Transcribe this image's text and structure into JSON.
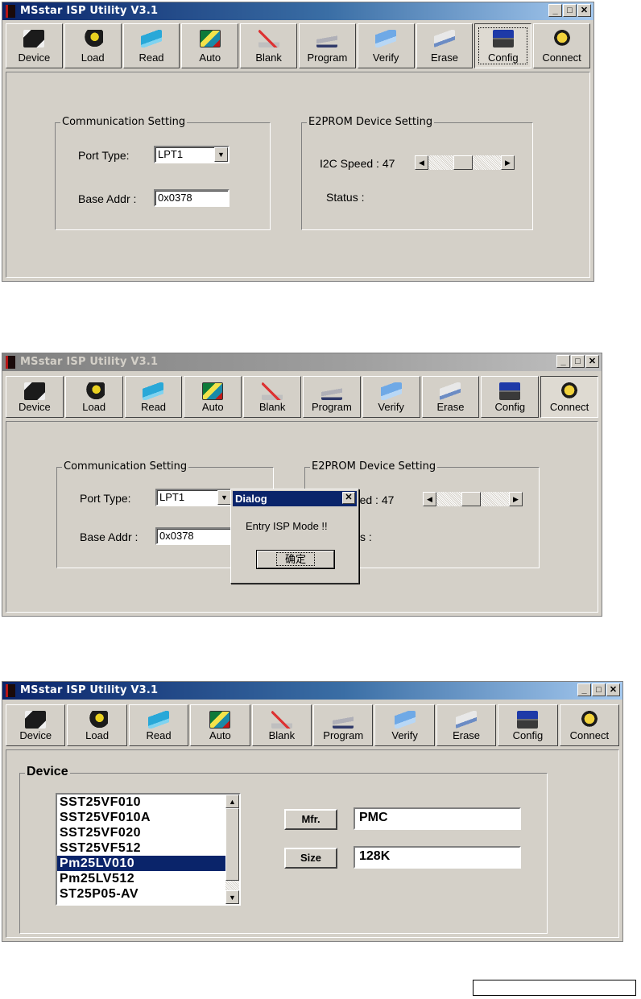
{
  "app": {
    "title": "MSstar ISP Utility V3.1"
  },
  "window_buttons": {
    "minimize": "_",
    "maximize": "□",
    "close": "✕"
  },
  "toolbar": [
    {
      "label": "Device",
      "icon": "device-chip-icon"
    },
    {
      "label": "Load",
      "icon": "load-chip-icon"
    },
    {
      "label": "Read",
      "icon": "read-book-icon"
    },
    {
      "label": "Auto",
      "icon": "auto-icon"
    },
    {
      "label": "Blank",
      "icon": "blank-check-icon"
    },
    {
      "label": "Program",
      "icon": "program-icon"
    },
    {
      "label": "Verify",
      "icon": "verify-icon"
    },
    {
      "label": "Erase",
      "icon": "erase-icon"
    },
    {
      "label": "Config",
      "icon": "config-computer-icon"
    },
    {
      "label": "Connect",
      "icon": "connect-phone-icon"
    }
  ],
  "config_panel": {
    "comm_group": "Communication Setting",
    "port_type_label": "Port Type:",
    "port_type_value": "LPT1",
    "base_addr_label": "Base Addr :",
    "base_addr_value": "0x0378",
    "e2prom_group": "E2PROM Device Setting",
    "i2c_speed_label": "I2C Speed :",
    "i2c_speed_value": "47",
    "i2c_speed_fraction": 0.47,
    "status_label": "Status :"
  },
  "dialog": {
    "title": "Dialog",
    "close": "✕",
    "message": "Entry ISP Mode !!",
    "ok_label": "确定",
    "occluded_speed_label": "peed :",
    "occluded_status_label": "s :"
  },
  "device_panel": {
    "group": "Device",
    "devices": [
      "SST25VF010",
      "SST25VF010A",
      "SST25VF020",
      "SST25VF512",
      "Pm25LV010",
      "Pm25LV512",
      "ST25P05-AV"
    ],
    "selected_device": "Pm25LV010",
    "mfr_button": "Mfr.",
    "mfr_value": "PMC",
    "size_button": "Size",
    "size_value": "128K"
  },
  "arrows": {
    "left": "◀",
    "right": "▶",
    "up": "▲",
    "down": "▼"
  }
}
